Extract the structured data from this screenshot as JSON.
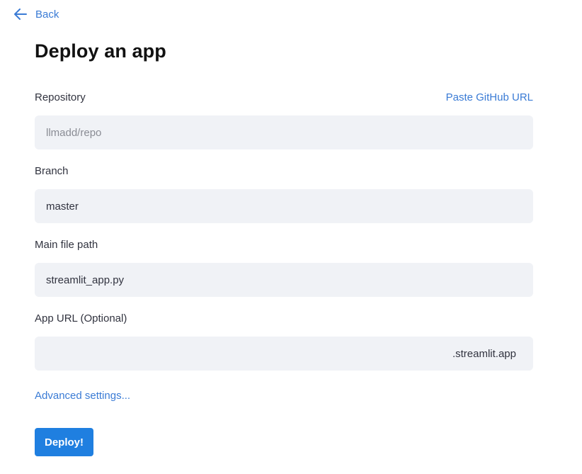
{
  "nav": {
    "back_label": "Back",
    "back_icon": "arrow-left-icon"
  },
  "page": {
    "title": "Deploy an app"
  },
  "form": {
    "repository": {
      "label": "Repository",
      "action_label": "Paste GitHub URL",
      "value": "",
      "placeholder": "llmadd/repo"
    },
    "branch": {
      "label": "Branch",
      "value": "master",
      "placeholder": ""
    },
    "main_file": {
      "label": "Main file path",
      "value": "streamlit_app.py",
      "placeholder": ""
    },
    "app_url": {
      "label": "App URL (Optional)",
      "value": "",
      "suffix": ".streamlit.app"
    },
    "advanced_label": "Advanced settings...",
    "deploy_label": "Deploy!"
  },
  "colors": {
    "accent": "#1f7fe0",
    "link": "#3a7bd5",
    "input_bg": "#f0f2f6",
    "text": "#31333f"
  }
}
